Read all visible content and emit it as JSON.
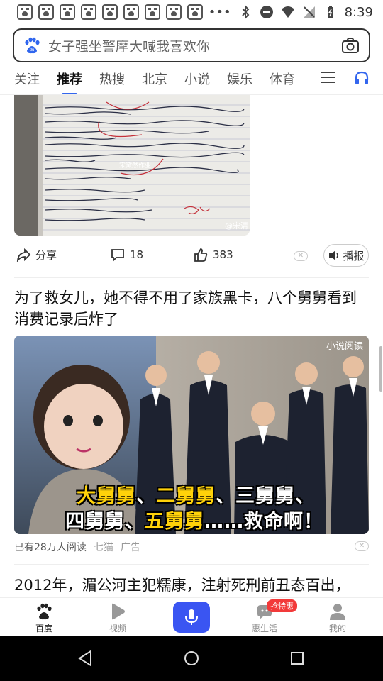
{
  "status_bar": {
    "notification_icon": "baidu-paw-icon",
    "notification_count": 9,
    "time": "8:39"
  },
  "search": {
    "query": "女子强坐警摩大喊我喜欢你"
  },
  "tabs": [
    {
      "label": "关注"
    },
    {
      "label": "推荐",
      "active": true
    },
    {
      "label": "热搜"
    },
    {
      "label": "北京"
    },
    {
      "label": "小说"
    },
    {
      "label": "娱乐"
    },
    {
      "label": "体育"
    }
  ],
  "card1": {
    "image_watermark": "@宋清",
    "image_center_text": "宋黛然作业",
    "share_label": "分享",
    "comment_count": "18",
    "like_count": "383",
    "play_label": "播报"
  },
  "card2": {
    "title": "为了救女儿，她不得不用了家族黑卡，八个舅舅看到消费记录后炸了",
    "image_tag": "小说阅读",
    "caption_line1_yellow": [
      "大舅舅",
      "二舅舅"
    ],
    "caption_line1_white": [
      "三舅舅"
    ],
    "caption_line1": "大舅舅、二舅舅、三舅舅、",
    "caption_line2_white_a": "四舅舅、",
    "caption_line2_yellow": "五舅舅",
    "caption_line2_white_b": "……救命啊！",
    "meta_reads": "已有28万人阅读",
    "meta_source": "七猫",
    "meta_ad": "广告"
  },
  "card3": {
    "title": "2012年，湄公河主犯糯康，注射死刑前丑态百出，"
  },
  "bottom_nav": [
    {
      "label": "百度",
      "icon": "baidu-paw-icon",
      "active": true
    },
    {
      "label": "视频",
      "icon": "play-icon"
    },
    {
      "label": "",
      "icon": "microphone-icon"
    },
    {
      "label": "惠生活",
      "icon": "chat-bubble-icon",
      "badge": "抢特惠"
    },
    {
      "label": "我的",
      "icon": "person-icon"
    }
  ],
  "colors": {
    "accent": "#3366ee",
    "voice_button": "#3a55f2",
    "badge": "#f23a3a",
    "caption_yellow": "#ffd20a"
  }
}
